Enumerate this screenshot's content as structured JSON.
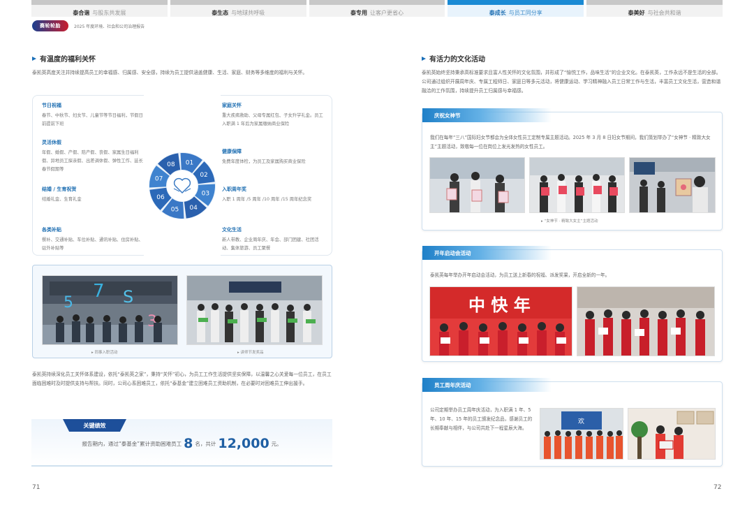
{
  "nav": {
    "tabs": [
      {
        "name": "泰合谐",
        "slogan": "与股东共发展"
      },
      {
        "name": "泰生态",
        "slogan": "与地球共呼吸"
      },
      {
        "name": "泰专用",
        "slogan": "让客户更省心"
      },
      {
        "name": "泰成长",
        "slogan": "与员工同分享"
      },
      {
        "name": "泰美好",
        "slogan": "与社会共和谐"
      }
    ]
  },
  "header": {
    "logo": "赛轮轮胎",
    "report_title": "2025 年度环境、社会和公司治理报告"
  },
  "left": {
    "section_title": "有温度的福利关怀",
    "intro": "泰凯英高度关注并持续提高员工的幸福感、归属感、安全感，持续为员工提供涵盖健康、生活、家庭、财务等多维度的福利与关怀。",
    "benefits_left": [
      {
        "title": "节日祝福",
        "desc": "春节、中秋节、妇女节、儿童节等节日福利，节假日前提前下班"
      },
      {
        "title": "灵活休假",
        "desc": "年假、婚假、产假、陪产假、丧假、家属生日福利假、异地员工探亲假、出差调休假、弹性工作、延长春节假期等"
      },
      {
        "title": "结婚 / 生育祝贺",
        "desc": "结婚礼金、生育礼金"
      },
      {
        "title": "各类补贴",
        "desc": "餐补、交通补贴、车位补贴、通讯补贴、住房补贴、驻外补贴等"
      }
    ],
    "benefits_right": [
      {
        "title": "家庭关怀",
        "desc": "重大疾病救助、父母专属红包、子女升学礼金。员工入职满 1 年后为家属缴纳商业保险"
      },
      {
        "title": "健康保障",
        "desc": "免费年度体检，为员工及家属购买商业保险"
      },
      {
        "title": "入职周年奖",
        "desc": "入职 1 周年 /5 周年 /10 周年 /15 周年纪念奖"
      },
      {
        "title": "文化生活",
        "desc": "新人带教、企业周年庆、年会、部门团建、社团活动、集体旅游、员工聚餐"
      }
    ],
    "wheel_numbers": [
      "01",
      "02",
      "03",
      "04",
      "05",
      "06",
      "07",
      "08"
    ],
    "photo_captions": [
      "同事入职活动",
      "讲师节发奖品"
    ],
    "closing": "泰凯英持续深化员工关怀体系建设，依托“泰凯英之家”，秉持“关怀”初心，为员工工作生活提供坚实保障，以温馨之心关爱每一位员工，在员工面临困难时及时提供支持与帮扶。同时，公司心系困难员工，依托“泰基金”建立困难员工资助机制，在必要时对困难员工伸出援手。",
    "key_performance": {
      "label": "关键绩效",
      "prefix": "报告期内，通过“泰基金”累计资助困难员工",
      "count": "8",
      "mid": "名，共计",
      "amount": "12,000",
      "suffix": "元。"
    },
    "page_number": "71"
  },
  "right": {
    "section_title": "有活力的文化活动",
    "intro": "泰凯英始终坚持秉承高标准要求且富人性关怀的文化氛围，并形成了“愉悦工作，品味生活”的企业文化。在泰凯英，工作永远不是生活的全部。公司通过组织开展周年庆、专属工程师日、家庭日等多元活动，将健康运动、学习精神融入员工日常工作与生活，丰富员工文化生活，营造和谐融洽的工作氛围，持续提升员工归属感与幸福感。",
    "panels": [
      {
        "title": "庆祝女神节",
        "text": "我们在每年“三八”国际妇女节都会为全体女性员工定制专属主题活动。2025 年 3 月 8 日妇女节期间，我们策划举办了“女神节 · 精致大女主”主题活动，致敬每一位在岗位上发光发热的女性员工。",
        "caption": "“女神节 · 精致大女主”主题活动"
      },
      {
        "title": "开年启动会活动",
        "text": "泰凯英每年举办开年启动会活动，为员工送上新春的祝福、派发奖果，开启全新的一年。"
      },
      {
        "title": "员工周年庆活动",
        "text": "公司定期举办员工周年庆活动，为入职满 1 年、5 年、10 年、15 年的员工颁发纪念品，感谢员工的长期奉献与相伴，与公司共赴下一程星辰大海。"
      }
    ],
    "page_number": "72"
  }
}
